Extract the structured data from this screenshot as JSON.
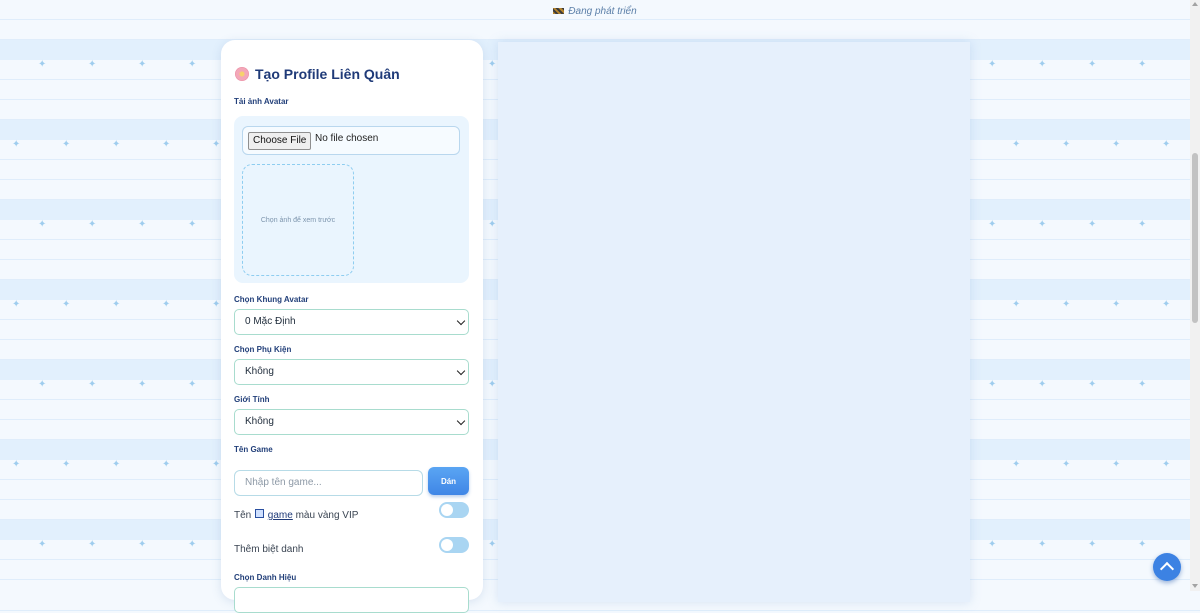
{
  "top_notice": {
    "text": "Đang phát triển",
    "icon": "construction-icon"
  },
  "form": {
    "title": "Tạo Profile Liên Quân",
    "title_icon": "cherry-blossom-icon",
    "avatar_upload": {
      "label": "Tải ảnh Avatar",
      "button_label": "Choose File",
      "file_status": "No file chosen",
      "preview_placeholder": "Chọn ảnh để xem trước"
    },
    "frame": {
      "label": "Chọn Khung Avatar",
      "selected": "0 Mặc Định"
    },
    "accessory": {
      "label": "Chọn Phụ Kiện",
      "selected": "Không"
    },
    "gender": {
      "label": "Giới Tính",
      "selected": "Không"
    },
    "game_name": {
      "label": "Tên Game",
      "placeholder": "Nhập tên game...",
      "paste_label": "Dán"
    },
    "vip_name_toggle": {
      "prefix": "Tên",
      "link": "game",
      "suffix": "màu vàng VIP",
      "enabled": false
    },
    "nickname_toggle": {
      "label": "Thêm biệt danh",
      "enabled": false
    },
    "title_select": {
      "label": "Chọn Danh Hiệu"
    }
  },
  "scroll_top_button": {
    "icon": "chevron-up-icon"
  },
  "colors": {
    "accent": "#3c82e3",
    "heading": "#1f3a78",
    "toggle_off": "#a9d5f2"
  }
}
